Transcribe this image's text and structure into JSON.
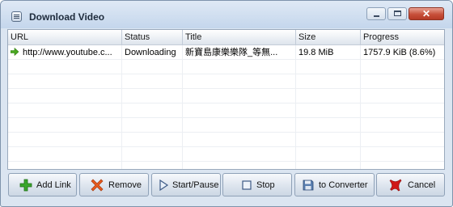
{
  "window": {
    "title": "Download Video",
    "accent": "#7e93ac"
  },
  "titlebar_buttons": {
    "minimize": "minimize-icon",
    "maximize": "maximize-icon",
    "close": "close-icon"
  },
  "columns": [
    "URL",
    "Status",
    "Title",
    "Size",
    "Progress"
  ],
  "rows": [
    {
      "url": "http://www.youtube.c...",
      "status": "Downloading",
      "title": "新寶島康樂樂隊_等無...",
      "size": "19.8 MiB",
      "progress": "1757.9 KiB (8.6%)",
      "progress_fraction": 0.086
    }
  ],
  "buttons": {
    "add_link": "Add Link",
    "remove": "Remove",
    "start_pause": "Start/Pause",
    "stop": "Stop",
    "to_converter": "to Converter",
    "cancel": "Cancel"
  },
  "colors": {
    "add": "#3aa62c",
    "remove": "#e85a1e",
    "cancel": "#d01818",
    "row_arrow": "#4aa820"
  }
}
